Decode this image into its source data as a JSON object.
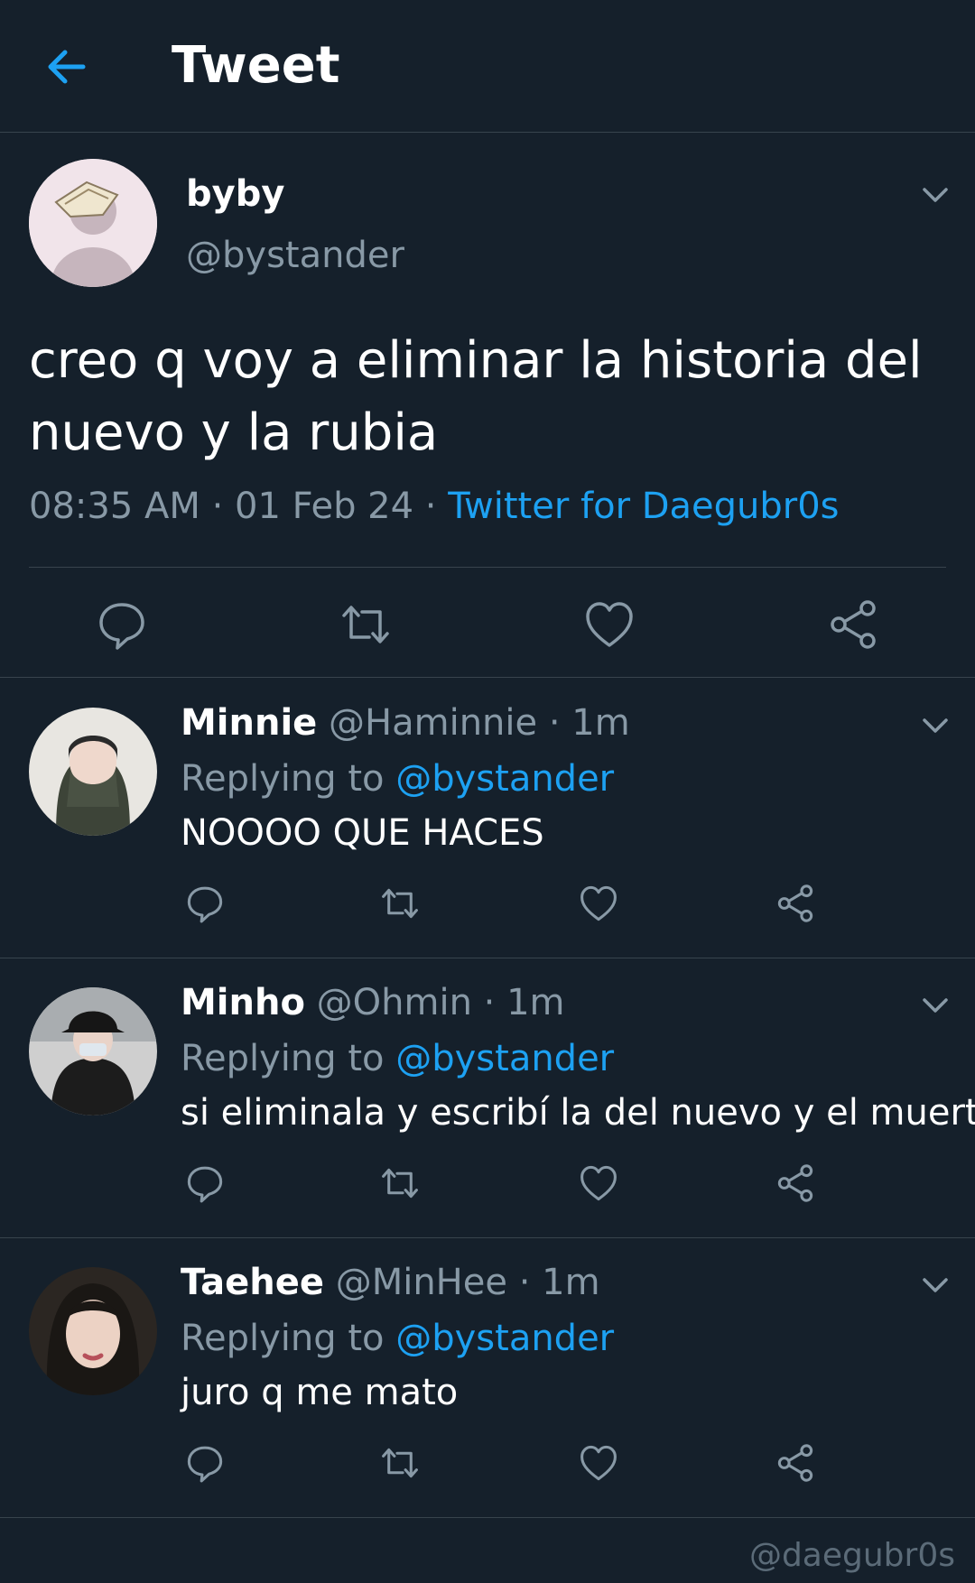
{
  "header": {
    "title": "Tweet",
    "back_icon": "arrow-left-icon"
  },
  "colors": {
    "background": "#15202b",
    "accent": "#1da1f2",
    "secondary_text": "#8899a6",
    "divider": "#38444d"
  },
  "main_tweet": {
    "author_name": "byby",
    "author_handle": "@bystander",
    "text": "creo q voy a eliminar la historia del nuevo y la rubia",
    "time": "08:35 AM",
    "date": "01 Feb 24",
    "separator": "·",
    "source": "Twitter for Daegubr0s",
    "actions": [
      "reply-icon",
      "retweet-icon",
      "like-icon",
      "share-icon"
    ]
  },
  "replies": [
    {
      "name": "Minnie",
      "handle": "@Haminnie",
      "time": "1m",
      "replying_label": "Replying to",
      "mention": "@bystander",
      "text": "NOOOO QUE HACES"
    },
    {
      "name": "Minho",
      "handle": "@Ohmin",
      "time": "1m",
      "replying_label": "Replying to",
      "mention": "@bystander",
      "text": "si eliminala y escribí la del nuevo y el muerto"
    },
    {
      "name": "Taehee",
      "handle": "@MinHee",
      "time": "1m",
      "replying_label": "Replying to",
      "mention": "@bystander",
      "text": "juro q me mato"
    }
  ],
  "watermark": "@daegubr0s"
}
